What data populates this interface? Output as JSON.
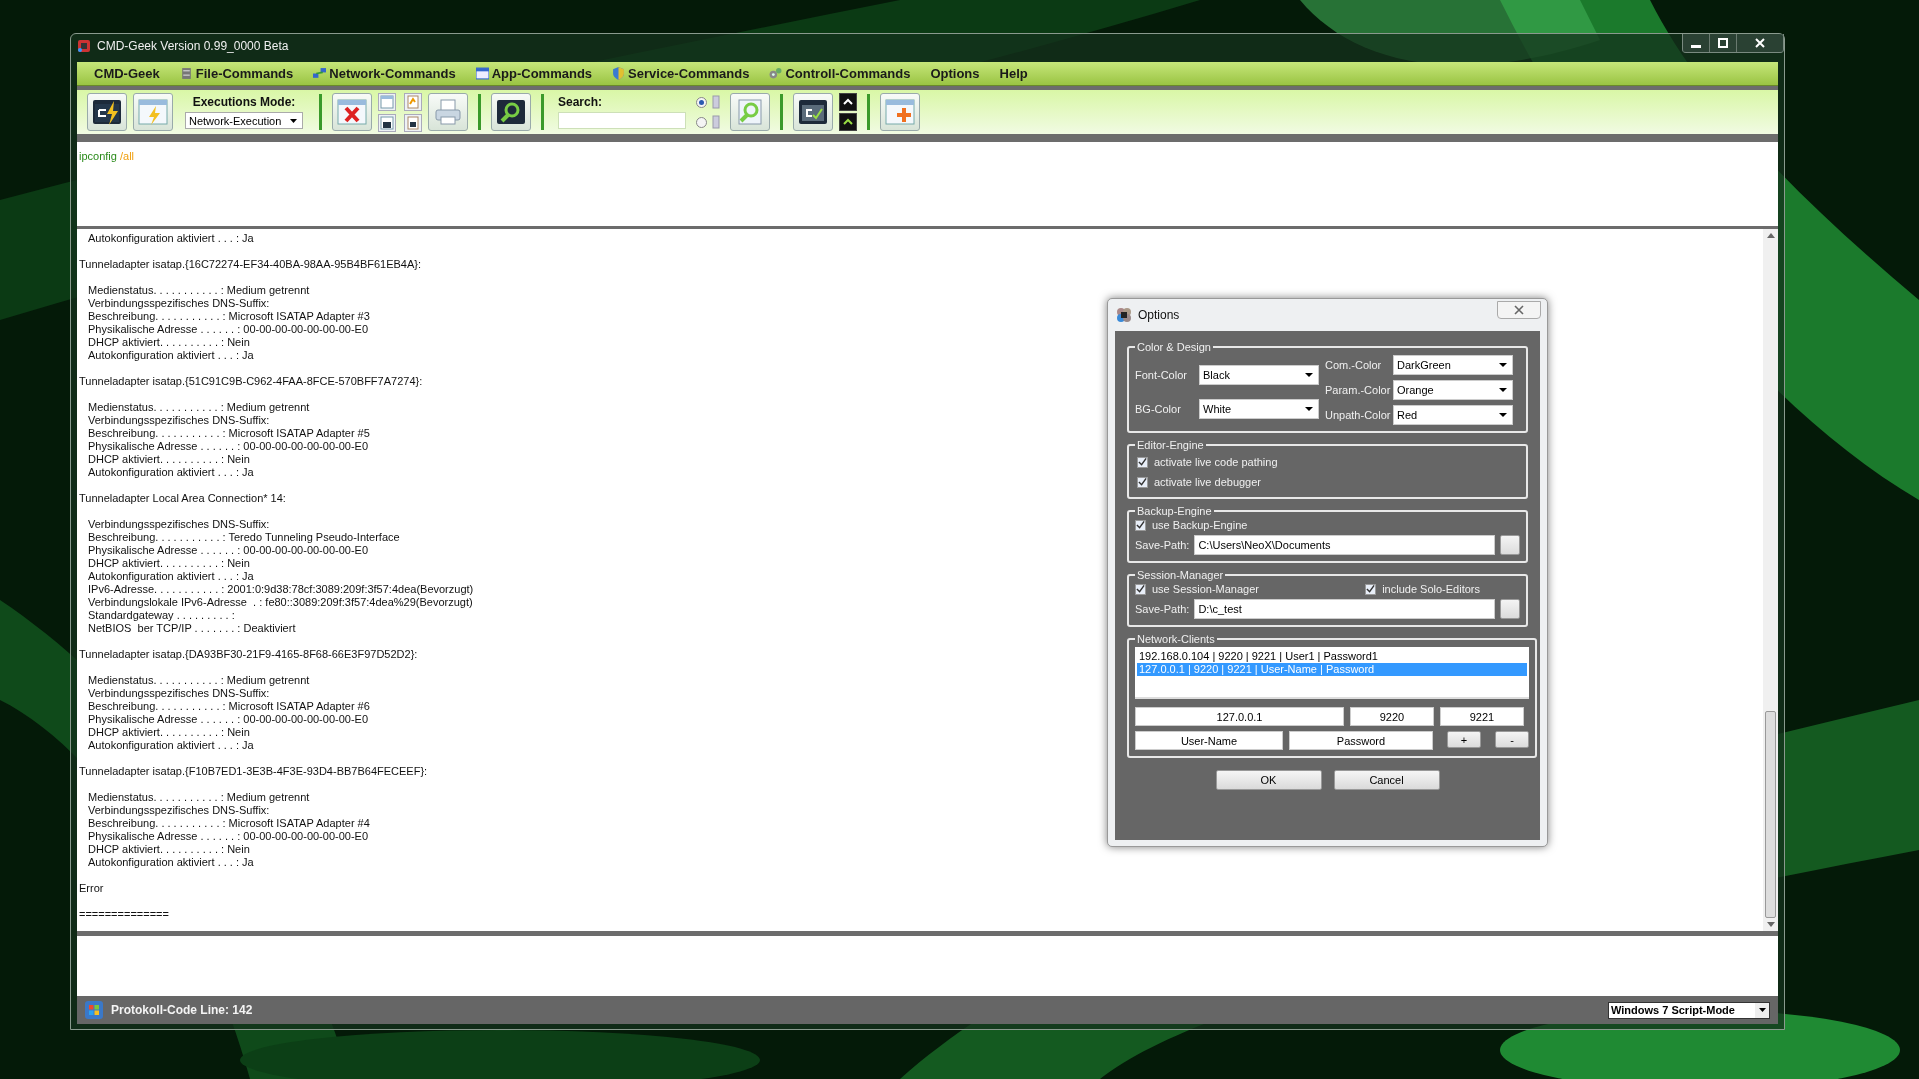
{
  "window": {
    "title": "CMD-Geek Version 0.99_0000 Beta"
  },
  "menu": [
    "CMD-Geek",
    "File-Commands",
    "Network-Commands",
    "App-Commands",
    "Service-Commands",
    "Controll-Commands",
    "Options",
    "Help"
  ],
  "toolbar": {
    "mode_label": "Executions Mode:",
    "mode_value": "Network-Execution",
    "search_label": "Search:",
    "search_scope": [
      {
        "selected": true
      },
      {
        "selected": false
      }
    ]
  },
  "command": {
    "name": "ipconfig",
    "param": "/all"
  },
  "output": {
    "blocks": [
      {
        "lines": [
          "Autokonfiguration aktiviert . . . : Ja"
        ]
      },
      {
        "header": "Tunneladapter isatap.{16C72274-EF34-40BA-98AA-95B4BF61EB4A}:",
        "lines": [
          "Medienstatus. . . . . . . . . . . : Medium getrennt",
          "Verbindungsspezifisches DNS-Suffix:",
          "Beschreibung. . . . . . . . . . . : Microsoft ISATAP Adapter #3",
          "Physikalische Adresse . . . . . . : 00-00-00-00-00-00-00-E0",
          "DHCP aktiviert. . . . . . . . . . : Nein",
          "Autokonfiguration aktiviert . . . : Ja"
        ]
      },
      {
        "header": "Tunneladapter isatap.{51C91C9B-C962-4FAA-8FCE-570BFF7A7274}:",
        "lines": [
          "Medienstatus. . . . . . . . . . . : Medium getrennt",
          "Verbindungsspezifisches DNS-Suffix:",
          "Beschreibung. . . . . . . . . . . : Microsoft ISATAP Adapter #5",
          "Physikalische Adresse . . . . . . : 00-00-00-00-00-00-00-E0",
          "DHCP aktiviert. . . . . . . . . . : Nein",
          "Autokonfiguration aktiviert . . . : Ja"
        ]
      },
      {
        "header": "Tunneladapter Local Area Connection* 14:",
        "lines": [
          "Verbindungsspezifisches DNS-Suffix:",
          "Beschreibung. . . . . . . . . . . : Teredo Tunneling Pseudo-Interface",
          "Physikalische Adresse . . . . . . : 00-00-00-00-00-00-00-E0",
          "DHCP aktiviert. . . . . . . . . . : Nein",
          "Autokonfiguration aktiviert . . . : Ja",
          "IPv6-Adresse. . . . . . . . . . . : 2001:0:9d38:78cf:3089:209f:3f57:4dea(Bevorzugt)",
          "Verbindungslokale IPv6-Adresse  . : fe80::3089:209f:3f57:4dea%29(Bevorzugt)",
          "Standardgateway . . . . . . . . . :",
          "NetBIOS  ber TCP/IP . . . . . . . : Deaktiviert"
        ]
      },
      {
        "header": "Tunneladapter isatap.{DA93BF30-21F9-4165-8F68-66E3F97D52D2}:",
        "lines": [
          "Medienstatus. . . . . . . . . . . : Medium getrennt",
          "Verbindungsspezifisches DNS-Suffix:",
          "Beschreibung. . . . . . . . . . . : Microsoft ISATAP Adapter #6",
          "Physikalische Adresse . . . . . . : 00-00-00-00-00-00-00-E0",
          "DHCP aktiviert. . . . . . . . . . : Nein",
          "Autokonfiguration aktiviert . . . : Ja"
        ]
      },
      {
        "header": "Tunneladapter isatap.{F10B7ED1-3E3B-4F3E-93D4-BB7B64FECEEF}:",
        "lines": [
          "Medienstatus. . . . . . . . . . . : Medium getrennt",
          "Verbindungsspezifisches DNS-Suffix:",
          "Beschreibung. . . . . . . . . . . : Microsoft ISATAP Adapter #4",
          "Physikalische Adresse . . . . . . : 00-00-00-00-00-00-00-E0",
          "DHCP aktiviert. . . . . . . . . . : Nein",
          "Autokonfiguration aktiviert . . . : Ja"
        ]
      },
      {
        "header": "Error"
      }
    ],
    "rule": "=============="
  },
  "status_bar": {
    "text": "Protokoll-Code Line: 142",
    "mode": "Windows 7 Script-Mode"
  },
  "dialog": {
    "title": "Options",
    "color_design": {
      "title": "Color & Design",
      "columns": [
        [
          {
            "label": "Font-Color",
            "value": "Black"
          },
          {
            "label": "BG-Color",
            "value": "White"
          }
        ],
        [
          {
            "label": "Com.-Color",
            "value": "DarkGreen"
          },
          {
            "label": "Param.-Color",
            "value": "Orange"
          },
          {
            "label": "Unpath-Color",
            "value": "Red"
          }
        ]
      ]
    },
    "editor_engine": {
      "title": "Editor-Engine",
      "options": [
        {
          "label": "activate live code pathing",
          "checked": true
        },
        {
          "label": "activate live debugger",
          "checked": true
        }
      ]
    },
    "backup_engine": {
      "title": "Backup-Engine",
      "option": {
        "label": "use Backup-Engine",
        "checked": true
      },
      "path_label": "Save-Path:",
      "path": "C:\\Users\\NeoX\\Documents"
    },
    "session_manager": {
      "title": "Session-Manager",
      "options": [
        {
          "label": "use Session-Manager",
          "checked": true
        },
        {
          "label": "include Solo-Editors",
          "checked": true
        }
      ],
      "path_label": "Save-Path:",
      "path": "D:\\c_test"
    },
    "network_clients": {
      "title": "Network-Clients",
      "items": [
        {
          "text": "192.168.0.104 | 9220 | 9221 | User1 | Password1",
          "selected": false
        },
        {
          "text": "127.0.0.1 | 9220 | 9221 | User-Name | Password",
          "selected": true
        }
      ],
      "address": "127.0.0.1",
      "port_1": "9220",
      "port_2": "9221",
      "user": "User-Name",
      "password": "Password",
      "add": "+",
      "remove": "-"
    },
    "buttons": [
      "OK",
      "Cancel"
    ]
  }
}
